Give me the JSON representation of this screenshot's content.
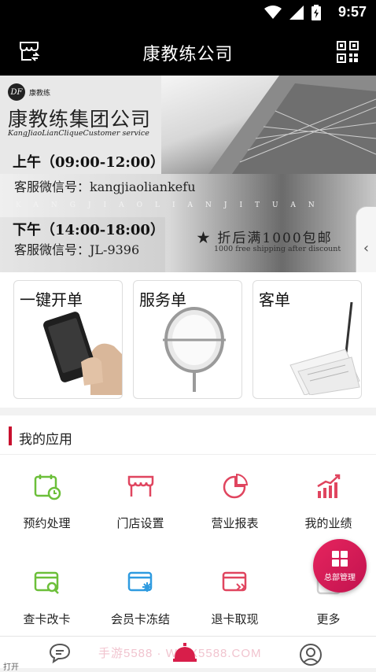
{
  "status_bar": {
    "time": "9:57"
  },
  "header": {
    "title": "康教练公司"
  },
  "banner": {
    "logo_mark": "DF",
    "logo_text": "康教练",
    "company": "康教练集团公司",
    "company_en": "KangJiaoLianCliqueCustomer service",
    "am_hours": "上午（09:00-12:00）",
    "am_wechat": "客服微信号：kangjiaoliankefu",
    "pinyin": "KANGJIAOLIANJITUAN",
    "pm_hours": "下午（14:00-18:00）",
    "pm_wechat": "客服微信号：JL-9396",
    "promo": "★ 折后满1000包邮",
    "promo_en": "1000 free shipping after discount"
  },
  "quick_actions": [
    {
      "label": "一键开单",
      "icon": "phone-in-hand-image"
    },
    {
      "label": "服务单",
      "icon": "mirror-image"
    },
    {
      "label": "客单",
      "icon": "receipt-spike-image"
    }
  ],
  "apps": {
    "title": "我的应用",
    "items": [
      {
        "label": "预约处理",
        "icon": "calendar-clock-icon",
        "color": "#6cbf3a"
      },
      {
        "label": "门店设置",
        "icon": "storefront-icon",
        "color": "#e0455f"
      },
      {
        "label": "营业报表",
        "icon": "pie-chart-icon",
        "color": "#e0455f"
      },
      {
        "label": "我的业绩",
        "icon": "bar-chart-up-icon",
        "color": "#e0455f"
      },
      {
        "label": "查卡改卡",
        "icon": "card-search-icon",
        "color": "#6cbf3a"
      },
      {
        "label": "会员卡冻结",
        "icon": "card-snowflake-icon",
        "color": "#2f9be0"
      },
      {
        "label": "退卡取现",
        "icon": "card-return-icon",
        "color": "#e0455f"
      },
      {
        "label": "更多",
        "icon": "more-icon",
        "color": "#999999"
      }
    ]
  },
  "fab": {
    "label": "总部管理"
  },
  "bottom_nav": {
    "watermark": "手游5588 · WWX5588.COM",
    "hint": "打开"
  }
}
